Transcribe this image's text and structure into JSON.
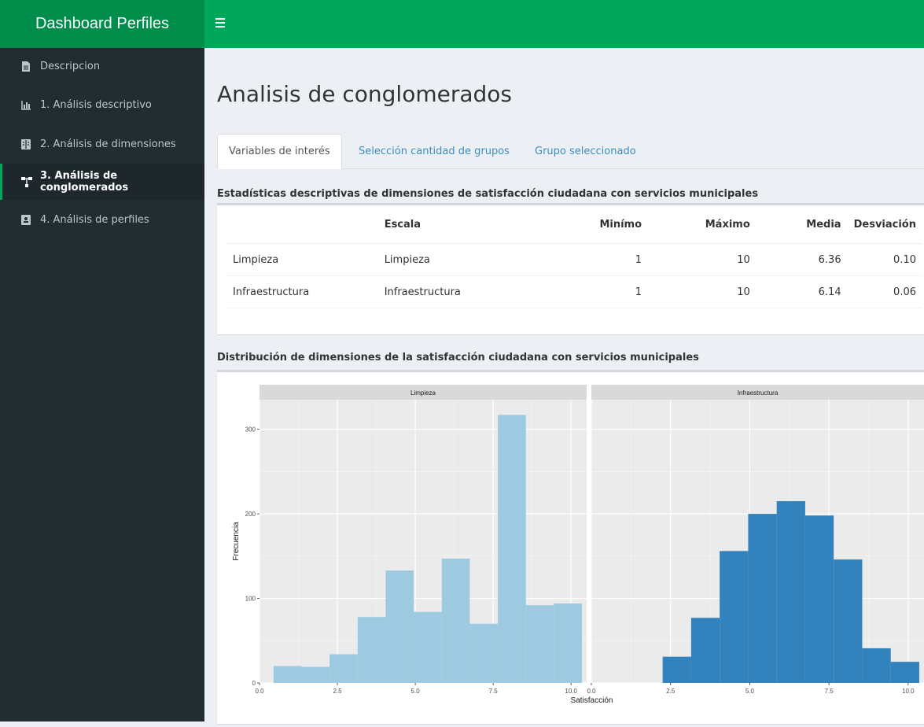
{
  "app": {
    "title": "Dashboard Perfiles"
  },
  "sidebar": {
    "items": [
      {
        "label": "Descripcion",
        "icon": "file-icon"
      },
      {
        "label": "1. Análisis descriptivo",
        "icon": "bar-chart-icon"
      },
      {
        "label": "2. Análisis de dimensiones",
        "icon": "columns-icon"
      },
      {
        "label": "3. Análisis de conglomerados",
        "icon": "sitemap-icon",
        "active": true
      },
      {
        "label": "4. Análisis de perfiles",
        "icon": "id-card-icon"
      }
    ]
  },
  "page": {
    "title": "Analisis de conglomerados"
  },
  "tabs": [
    {
      "label": "Variables de interés",
      "active": true
    },
    {
      "label": "Selección cantidad de grupos"
    },
    {
      "label": "Grupo seleccionado"
    }
  ],
  "stats": {
    "heading": "Estadísticas descriptivas de dimensiones de satisfacción ciudadana con servicios municipales",
    "columns": [
      "",
      "Escala",
      "Minímo",
      "Máximo",
      "Media",
      "Desviación"
    ],
    "rows": [
      [
        "Limpieza",
        "Limpieza",
        "1",
        "10",
        "6.36",
        "0.10"
      ],
      [
        "Infraestructura",
        "Infraestructura",
        "1",
        "10",
        "6.14",
        "0.06"
      ]
    ]
  },
  "chart_heading": "Distribución de dimensiones de la satisfacción ciudadana con servicios municipales",
  "chart_data": {
    "type": "bar",
    "xlabel": "Satisfacción",
    "ylabel": "Frecuencia",
    "ylim": [
      0,
      335
    ],
    "xlim": [
      0,
      10.5
    ],
    "x_ticks": [
      0.0,
      2.5,
      5.0,
      7.5,
      10.0
    ],
    "x_tick_labels": [
      "0.0",
      "2.5",
      "5.0",
      "7.5",
      "10.0"
    ],
    "y_ticks": [
      0,
      100,
      200,
      300
    ],
    "grid": true,
    "panels": [
      {
        "name": "Limpieza",
        "color": "#9ecae1",
        "bins": [
          {
            "x0": 0.45,
            "x1": 1.35,
            "value": 20
          },
          {
            "x0": 1.35,
            "x1": 2.25,
            "value": 19
          },
          {
            "x0": 2.25,
            "x1": 3.15,
            "value": 34
          },
          {
            "x0": 3.15,
            "x1": 4.05,
            "value": 78
          },
          {
            "x0": 4.05,
            "x1": 4.95,
            "value": 133
          },
          {
            "x0": 4.95,
            "x1": 5.85,
            "value": 84
          },
          {
            "x0": 5.85,
            "x1": 6.75,
            "value": 147
          },
          {
            "x0": 6.75,
            "x1": 7.65,
            "value": 70
          },
          {
            "x0": 7.65,
            "x1": 8.55,
            "value": 317
          },
          {
            "x0": 8.55,
            "x1": 9.45,
            "value": 92
          },
          {
            "x0": 9.45,
            "x1": 10.35,
            "value": 94
          }
        ]
      },
      {
        "name": "Infraestructura",
        "color": "#3182bd",
        "bins": [
          {
            "x0": 2.25,
            "x1": 3.15,
            "value": 31
          },
          {
            "x0": 3.15,
            "x1": 4.05,
            "value": 77
          },
          {
            "x0": 4.05,
            "x1": 4.95,
            "value": 156
          },
          {
            "x0": 4.95,
            "x1": 5.85,
            "value": 200
          },
          {
            "x0": 5.85,
            "x1": 6.75,
            "value": 215
          },
          {
            "x0": 6.75,
            "x1": 7.65,
            "value": 198
          },
          {
            "x0": 7.65,
            "x1": 8.55,
            "value": 146
          },
          {
            "x0": 8.55,
            "x1": 9.45,
            "value": 41
          },
          {
            "x0": 9.45,
            "x1": 10.35,
            "value": 25
          }
        ]
      }
    ]
  }
}
